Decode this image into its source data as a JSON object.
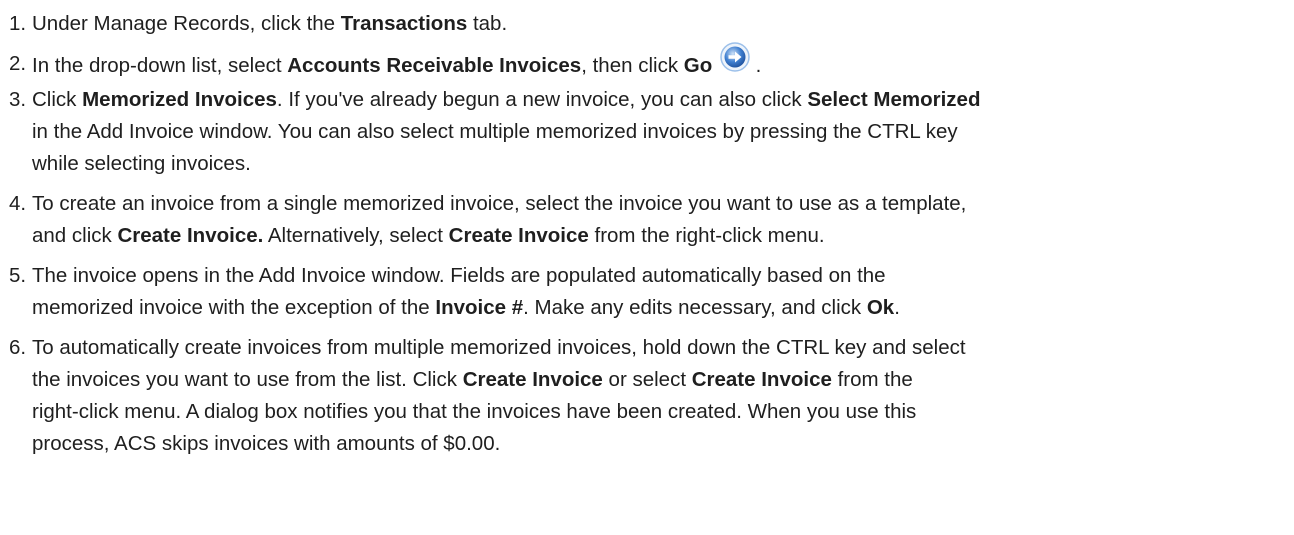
{
  "steps": [
    {
      "num": "1.",
      "parts": [
        {
          "text": "Under Manage Records, click the "
        },
        {
          "text": "Transactions",
          "bold": true
        },
        {
          "text": " tab."
        }
      ]
    },
    {
      "num": "2.",
      "parts": [
        {
          "text": "In the drop-down list, select "
        },
        {
          "text": "Accounts Receivable Invoices",
          "bold": true
        },
        {
          "text": ", then click "
        },
        {
          "text": "Go",
          "bold": true
        },
        {
          "text": " "
        },
        {
          "icon": "go-arrow-icon"
        },
        {
          "text": " ."
        }
      ]
    },
    {
      "num": "3.",
      "parts": [
        {
          "text": "Click "
        },
        {
          "text": "Memorized Invoices",
          "bold": true
        },
        {
          "text": ". If you've already begun a new invoice, you can also click "
        },
        {
          "text": "Select Memorized",
          "bold": true
        },
        {
          "break": true
        },
        {
          "text": "in the Add Invoice window. You can also select multiple memorized invoices by pressing the CTRL key"
        },
        {
          "break": true
        },
        {
          "text": "while selecting invoices."
        }
      ]
    },
    {
      "num": "4.",
      "parts": [
        {
          "text": "To create an invoice from a single memorized invoice, select the invoice you want to use as a template,"
        },
        {
          "break": true
        },
        {
          "text": "and click "
        },
        {
          "text": "Create Invoice.",
          "bold": true
        },
        {
          "text": " Alternatively, select "
        },
        {
          "text": "Create Invoice",
          "bold": true
        },
        {
          "text": " from the right-click menu."
        }
      ]
    },
    {
      "num": "5.",
      "parts": [
        {
          "text": "The invoice opens in the Add Invoice window. Fields are populated automatically based on the"
        },
        {
          "break": true
        },
        {
          "text": "memorized invoice with the exception of the "
        },
        {
          "text": "Invoice #",
          "bold": true
        },
        {
          "text": ". Make any edits necessary, and click "
        },
        {
          "text": "Ok",
          "bold": true
        },
        {
          "text": "."
        }
      ]
    },
    {
      "num": "6.",
      "parts": [
        {
          "text": "To automatically create invoices from multiple memorized invoices, hold down the CTRL key and select"
        },
        {
          "break": true
        },
        {
          "text": "the invoices you want to use from the list. Click "
        },
        {
          "text": "Create Invoice",
          "bold": true
        },
        {
          "text": " or select "
        },
        {
          "text": "Create Invoice",
          "bold": true
        },
        {
          "text": " from the"
        },
        {
          "break": true
        },
        {
          "text": "right-click menu. A dialog box notifies you that the invoices have been created. When you use this"
        },
        {
          "break": true
        },
        {
          "text": "process, ACS skips invoices with amounts of $0.00."
        }
      ]
    }
  ],
  "colors": {
    "text": "#1f1f1f",
    "go_icon_fill": "#3f7fd0",
    "go_icon_ring": "#9cc0ea"
  }
}
